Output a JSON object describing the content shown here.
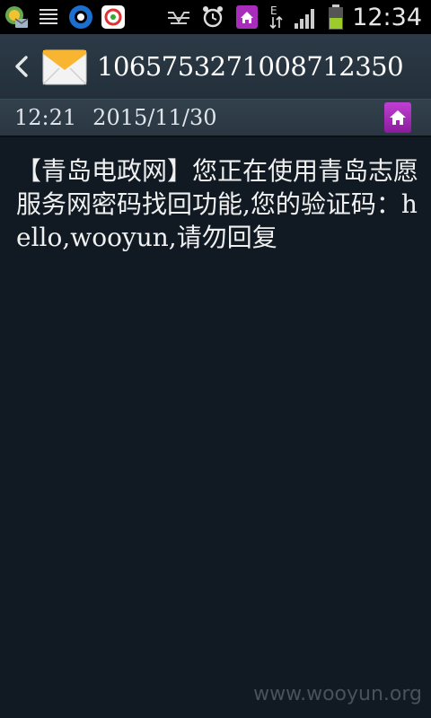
{
  "status_bar": {
    "icons_left": [
      "call-forward-icon",
      "menu-lines-icon",
      "browser-icon",
      "app-store-icon"
    ],
    "icons_right": [
      "vibrate-icon",
      "alarm-icon",
      "home-app-icon",
      "data-edge-icon",
      "signal-icon",
      "battery-icon"
    ],
    "data_indicator": "E",
    "time": "12:34"
  },
  "header": {
    "sender": "1065753271008712350"
  },
  "meta": {
    "time": "12:21",
    "date": "2015/11/30"
  },
  "message": {
    "body": "【青岛电政网】您正在使用青岛志愿服务网密码找回功能,您的验证码：hello,wooyun,请勿回复"
  },
  "watermark": "www.wooyun.org",
  "colors": {
    "background": "#111a22",
    "header": "#2c3a47",
    "accent": "#a82dbb"
  }
}
